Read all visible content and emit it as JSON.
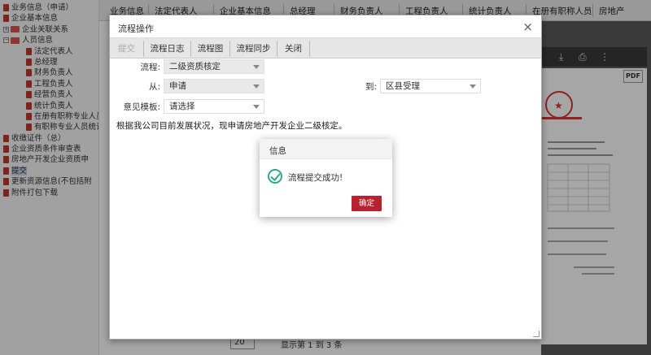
{
  "sidebar": {
    "items": [
      {
        "label": "业务信息（申请）",
        "level": "lv0",
        "type": "doc"
      },
      {
        "label": "企业基本信息",
        "level": "lv0",
        "type": "doc"
      },
      {
        "label": "企业关联关系",
        "level": "lv0",
        "type": "folder-collapsed",
        "expander": "+"
      },
      {
        "label": "人员信息",
        "level": "lv0",
        "type": "folder-open",
        "expander": "−"
      },
      {
        "label": "法定代表人",
        "level": "lv1",
        "type": "doc"
      },
      {
        "label": "总经理",
        "level": "lv1",
        "type": "doc"
      },
      {
        "label": "财务负责人",
        "level": "lv1",
        "type": "doc"
      },
      {
        "label": "工程负责人",
        "level": "lv1",
        "type": "doc"
      },
      {
        "label": "经营负责人",
        "level": "lv1",
        "type": "doc"
      },
      {
        "label": "统计负责人",
        "level": "lv1",
        "type": "doc"
      },
      {
        "label": "在册有职称专业人员",
        "level": "lv1",
        "type": "doc"
      },
      {
        "label": "有职称专业人员统计",
        "level": "lv1",
        "type": "doc"
      },
      {
        "label": "收缴证件（总）",
        "level": "lv0",
        "type": "doc"
      },
      {
        "label": "企业资质条件审查表",
        "level": "lv0",
        "type": "doc"
      },
      {
        "label": "房地产开发企业资质申",
        "level": "lv0",
        "type": "doc"
      },
      {
        "label": "提交",
        "level": "lv0",
        "type": "doc",
        "selected": true
      },
      {
        "label": "更新资源信息(不包括附",
        "level": "lv0",
        "type": "doc"
      },
      {
        "label": "附件打包下载",
        "level": "lv0",
        "type": "doc"
      }
    ]
  },
  "topbar": {
    "headers": [
      "业务信息",
      "法定代表人",
      "企业基本信息",
      "总经理",
      "财务负责人",
      "工程负责人",
      "统计负责人",
      "在册有职称人员",
      "房地产"
    ]
  },
  "flow_dialog": {
    "title": "流程操作",
    "close_glyph": "×",
    "tabs": [
      {
        "label": "提交",
        "disabled": true
      },
      {
        "label": "流程日志",
        "disabled": false
      },
      {
        "label": "流程图",
        "disabled": false
      },
      {
        "label": "流程同步",
        "disabled": false
      },
      {
        "label": "关闭",
        "disabled": false
      }
    ],
    "flow_label": "流程:",
    "flow_value": "二级资质核定",
    "from_label": "从:",
    "from_value": "申请",
    "to_label": "到:",
    "to_value": "区县受理",
    "template_label": "意见模板:",
    "template_value": "请选择",
    "opinion_text": "根据我公司目前发展状况，现申请房地产开发企业二级核定。"
  },
  "info_modal": {
    "title": "信息",
    "message": "流程提交成功!",
    "ok_label": "确定",
    "accent": "#b92030",
    "check_color": "#2fa88f"
  },
  "pdf_viewer": {
    "badge": "PDF",
    "download_icon": "download-icon",
    "print_icon": "print-icon",
    "more_icon": "more-icon"
  },
  "pager": {
    "page_size": "20",
    "summary": "显示第 1 到 3 条"
  }
}
